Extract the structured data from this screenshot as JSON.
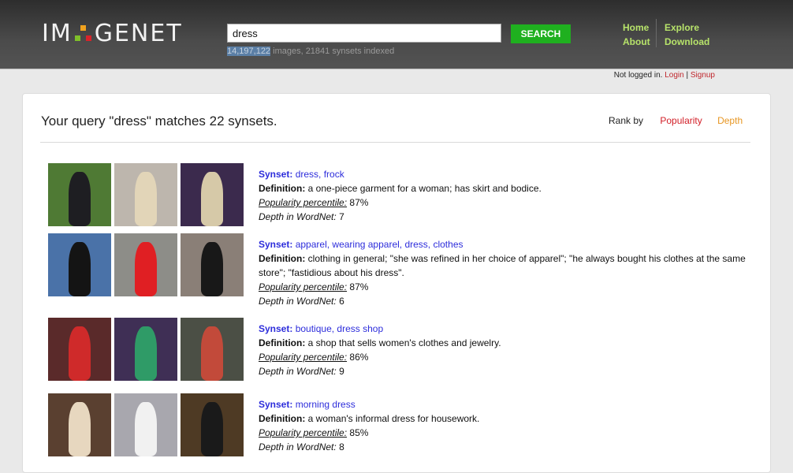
{
  "header": {
    "logo": {
      "left": "IM",
      "right": "GENET"
    },
    "search": {
      "value": "dress",
      "button": "SEARCH"
    },
    "stats": {
      "highlight": "14,197,122",
      "rest": " images, 21841 synsets indexed"
    },
    "nav": {
      "home": "Home",
      "about": "About",
      "explore": "Explore",
      "download": "Download"
    }
  },
  "login": {
    "text": "Not logged in.",
    "login": "Login",
    "sep": " | ",
    "signup": "Signup"
  },
  "panel": {
    "query_text": "Your query \"dress\" matches 22 synsets.",
    "rank_by": "Rank by",
    "rank_popularity": "Popularity",
    "rank_depth": "Depth"
  },
  "labels": {
    "synset": "Synset:",
    "definition": "Definition:",
    "popularity": "Popularity percentile:",
    "depth": "Depth in WordNet:"
  },
  "results": [
    {
      "synset": "dress, frock",
      "definition": "a one-piece garment for a woman; has skirt and bodice.",
      "popularity": "87%",
      "depth": "7",
      "thumbs": [
        {
          "bg": "#4f7a34",
          "fig": "#1e1e22"
        },
        {
          "bg": "#bdb6ad",
          "fig": "#e2d5b8"
        },
        {
          "bg": "#3b2a4d",
          "fig": "#d6c9a8"
        }
      ]
    },
    {
      "synset": "apparel, wearing apparel, dress, clothes",
      "definition": "clothing in general; \"she was refined in her choice of apparel\"; \"he always bought his clothes at the same store\"; \"fastidious about his dress\".",
      "popularity": "87%",
      "depth": "6",
      "thumbs": [
        {
          "bg": "#4a72a8",
          "fig": "#141414"
        },
        {
          "bg": "#8d8d88",
          "fig": "#e01f23"
        },
        {
          "bg": "#8a7f77",
          "fig": "#181818"
        }
      ]
    },
    {
      "synset": "boutique, dress shop",
      "definition": "a shop that sells women's clothes and jewelry.",
      "popularity": "86%",
      "depth": "9",
      "thumbs": [
        {
          "bg": "#5a2a2a",
          "fig": "#cf2a2a"
        },
        {
          "bg": "#3f2f55",
          "fig": "#2f9b67"
        },
        {
          "bg": "#4b4f45",
          "fig": "#c24a3a"
        }
      ]
    },
    {
      "synset": "morning dress",
      "definition": "a woman's informal dress for housework.",
      "popularity": "85%",
      "depth": "8",
      "thumbs": [
        {
          "bg": "#5a4030",
          "fig": "#e7d7bf"
        },
        {
          "bg": "#a8a7ae",
          "fig": "#f1f1f1"
        },
        {
          "bg": "#4e3a24",
          "fig": "#1a1a1a"
        }
      ]
    }
  ]
}
